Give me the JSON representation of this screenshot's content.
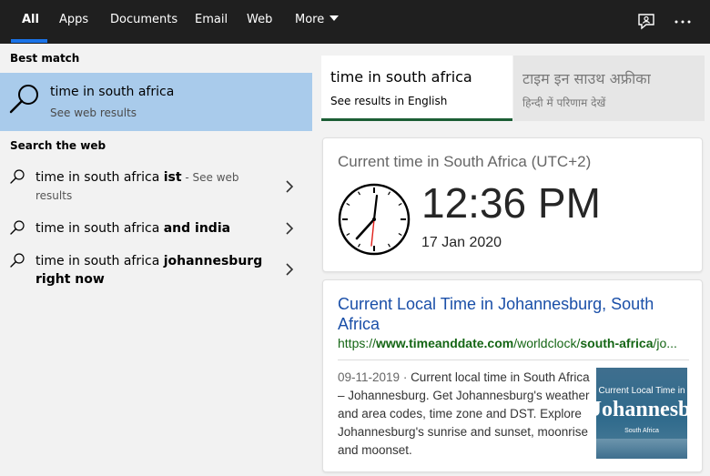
{
  "tabs": [
    {
      "label": "All"
    },
    {
      "label": "Apps"
    },
    {
      "label": "Documents"
    },
    {
      "label": "Email"
    },
    {
      "label": "Web"
    },
    {
      "label": "More"
    }
  ],
  "top_icons": [
    "feedback-icon",
    "more-options-icon"
  ],
  "left": {
    "best_match_heading": "Best match",
    "best_match": {
      "title": "time in south africa",
      "subtitle": "See web results",
      "icon": "search-icon"
    },
    "search_web_heading": "Search the web",
    "suggestions": [
      {
        "prefix": "time in south africa ",
        "bold": "ist",
        "suffix": " - See web results"
      },
      {
        "prefix": "time in south africa ",
        "bold": "and india",
        "suffix": ""
      },
      {
        "prefix": "time in south africa ",
        "bold": "johannesburg right now",
        "suffix": ""
      }
    ]
  },
  "right": {
    "language_tabs": [
      {
        "title": "time in south africa",
        "subtitle": "See results in English"
      },
      {
        "title": "टाइम इन साउथ अफ्रीका",
        "subtitle": "हिन्दी में परिणाम देखें"
      }
    ],
    "time_card": {
      "heading": "Current time in South Africa (UTC+2)",
      "time": "12:36 PM",
      "date": "17 Jan 2020"
    },
    "web_result": {
      "title": "Current Local Time in Johannesburg, South Africa",
      "url_prefix": "https://",
      "url_bold1": "www.timeanddate.com",
      "url_mid": "/worldclock/",
      "url_bold2": "south-africa",
      "url_suffix": "/jo...",
      "date": "09-11-2019",
      "separator": " · ",
      "description": "Current local time in South Africa – Johannesburg. Get Johannesburg's weather and area codes, time zone and DST. Explore Johannesburg's sunrise and sunset, moonrise and moonset.",
      "thumbnail": {
        "line1": "Current Local Time in",
        "line2": "Johannesburg",
        "line3": "South Africa"
      }
    }
  },
  "colors": {
    "accent": "#1a73e8",
    "selected": "#a9cbeb",
    "link": "#1a4fa8",
    "url": "#156615",
    "topbar": "#1f1f1f"
  }
}
